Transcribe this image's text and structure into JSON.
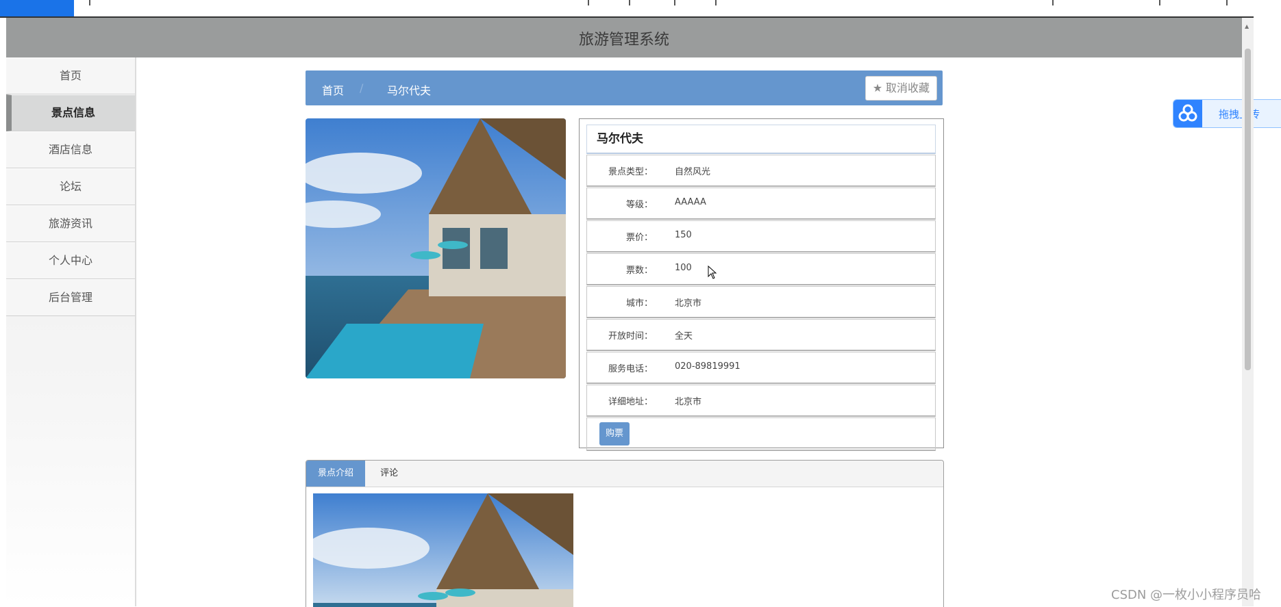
{
  "app": {
    "title": "旅游管理系统"
  },
  "sidebar": {
    "items": [
      {
        "label": "首页"
      },
      {
        "label": "景点信息",
        "active": true
      },
      {
        "label": "酒店信息"
      },
      {
        "label": "论坛"
      },
      {
        "label": "旅游资讯"
      },
      {
        "label": "个人中心"
      },
      {
        "label": "后台管理"
      }
    ]
  },
  "breadcrumb": {
    "home": "首页",
    "current": "马尔代夫",
    "separator": "/"
  },
  "favorite": {
    "label": "取消收藏",
    "icon": "star-icon"
  },
  "detail": {
    "name": "马尔代夫",
    "fields": [
      {
        "key": "景点类型：",
        "value": "自然风光"
      },
      {
        "key": "等级：",
        "value": "AAAAA"
      },
      {
        "key": "票价：",
        "value": "150"
      },
      {
        "key": "票数：",
        "value": "100"
      },
      {
        "key": "城市：",
        "value": "北京市"
      },
      {
        "key": "开放时间：",
        "value": "全天"
      },
      {
        "key": "服务电话：",
        "value": "020-89819991"
      },
      {
        "key": "详细地址：",
        "value": "北京市"
      }
    ],
    "buy_label": "购票"
  },
  "tabs": [
    {
      "label": "景点介绍",
      "active": true
    },
    {
      "label": "评论"
    }
  ],
  "upload_widget": {
    "label": "拖拽上传",
    "icon": "baidu-cloud-icon"
  },
  "watermark": "CSDN @一枚小小程序员哈",
  "colors": {
    "accent": "#6596ce",
    "header": "#9a9c9c",
    "upload": "#2f83ff"
  }
}
